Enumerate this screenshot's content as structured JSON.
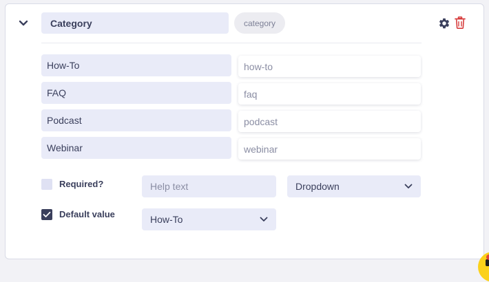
{
  "field": {
    "name": "Category",
    "slug": "category"
  },
  "options": [
    {
      "label": "How-To",
      "value": "how-to"
    },
    {
      "label": "FAQ",
      "value": "faq"
    },
    {
      "label": "Podcast",
      "value": "podcast"
    },
    {
      "label": "Webinar",
      "value": "webinar"
    }
  ],
  "settings": {
    "required_label": "Required?",
    "required_checked": false,
    "help_placeholder": "Help text",
    "field_type": "Dropdown",
    "default_label": "Default value",
    "default_checked": true,
    "default_value": "How-To"
  },
  "icons": {
    "collapse": "chevron-down-icon",
    "settings": "gear-icon",
    "delete": "trash-icon",
    "chat": "chat-icon"
  },
  "colors": {
    "accent": "#3a3f5c",
    "field_bg": "#e9ebf8",
    "delete": "#d63b3b",
    "chat": "#fbd11a"
  }
}
